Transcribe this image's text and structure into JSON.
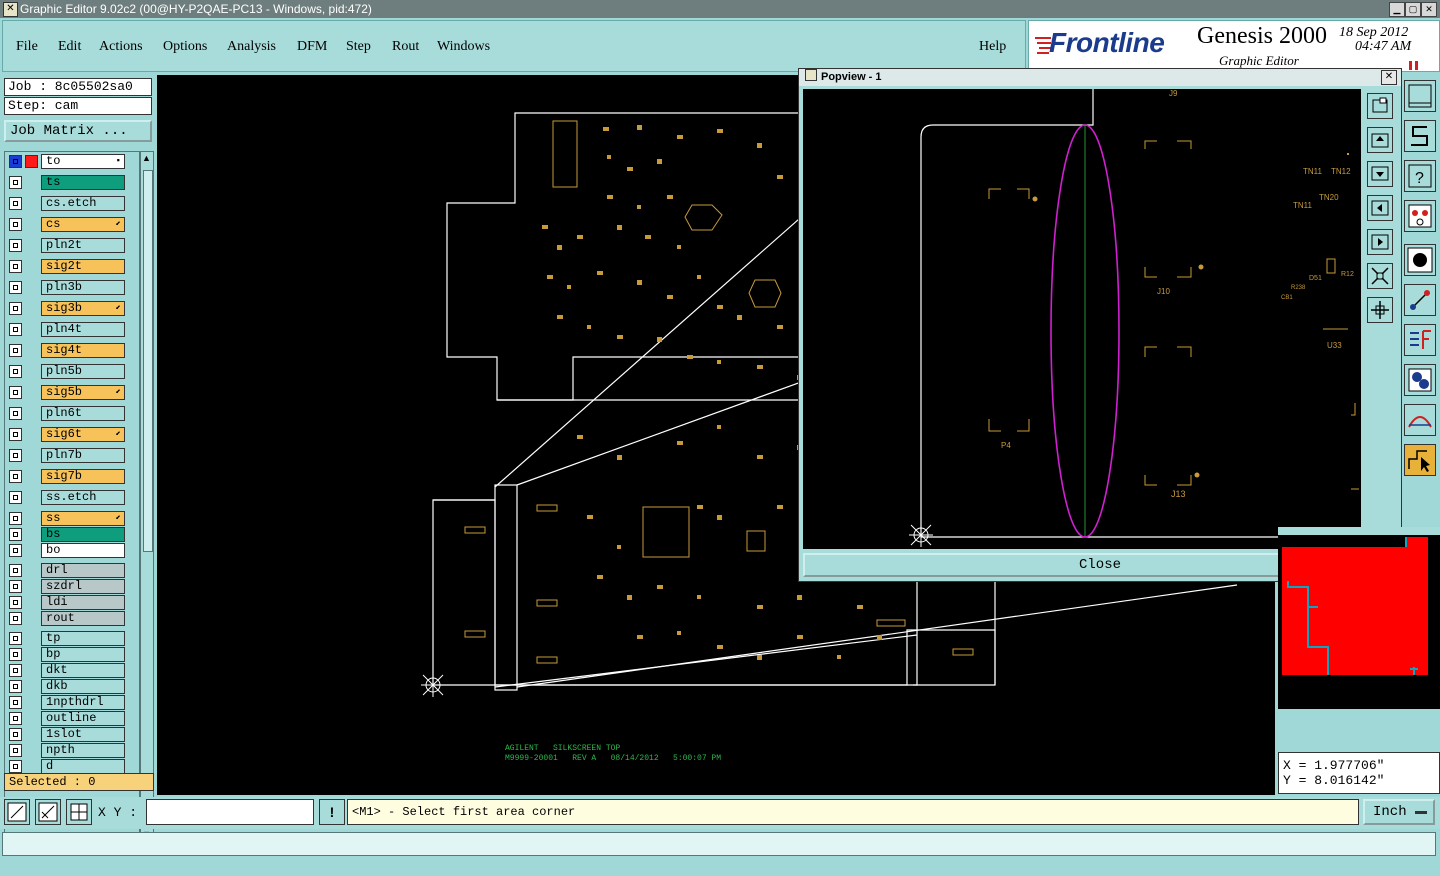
{
  "window": {
    "title": "Graphic Editor 9.02c2 (00@HY-P2QAE-PC13 - Windows, pid:472)"
  },
  "menu": {
    "file": "File",
    "edit": "Edit",
    "actions": "Actions",
    "options": "Options",
    "analysis": "Analysis",
    "dfm": "DFM",
    "step": "Step",
    "rout": "Rout",
    "windows": "Windows",
    "help": "Help"
  },
  "brand": {
    "logo": "Frontline",
    "product": "Genesis 2000",
    "subtitle": "Graphic Editor",
    "date": "18 Sep 2012",
    "time": "04:47 AM"
  },
  "left": {
    "job": "Job : 8c05502sa0",
    "step": "Step: cam",
    "job_matrix": "Job Matrix ...",
    "selected": "Selected : 0"
  },
  "layers": [
    {
      "name": "to",
      "color": "#ffffff",
      "mark": "▪"
    },
    {
      "name": "ts",
      "color": "#0e9d7d",
      "mark": ""
    },
    {
      "name": "cs.etch",
      "color": "#a7dcda",
      "mark": ""
    },
    {
      "name": "cs",
      "color": "#f7c25a",
      "mark": "⬋"
    },
    {
      "name": "pln2t",
      "color": "#a7dcda",
      "mark": ""
    },
    {
      "name": "sig2t",
      "color": "#f7c25a",
      "mark": ""
    },
    {
      "name": "pln3b",
      "color": "#a7dcda",
      "mark": ""
    },
    {
      "name": "sig3b",
      "color": "#f7c25a",
      "mark": "⬋"
    },
    {
      "name": "pln4t",
      "color": "#a7dcda",
      "mark": ""
    },
    {
      "name": "sig4t",
      "color": "#f7c25a",
      "mark": ""
    },
    {
      "name": "pln5b",
      "color": "#a7dcda",
      "mark": ""
    },
    {
      "name": "sig5b",
      "color": "#f7c25a",
      "mark": "⬋"
    },
    {
      "name": "pln6t",
      "color": "#a7dcda",
      "mark": ""
    },
    {
      "name": "sig6t",
      "color": "#f7c25a",
      "mark": "⬋"
    },
    {
      "name": "pln7b",
      "color": "#a7dcda",
      "mark": ""
    },
    {
      "name": "sig7b",
      "color": "#f7c25a",
      "mark": ""
    },
    {
      "name": "ss.etch",
      "color": "#a7dcda",
      "mark": ""
    },
    {
      "name": "ss",
      "color": "#f7c25a",
      "mark": "⬋"
    },
    {
      "name": "bs",
      "color": "#0e9d7d",
      "mark": ""
    },
    {
      "name": "bo",
      "color": "#ffffff",
      "mark": ""
    },
    {
      "name": "drl",
      "color": "#b8c8c8",
      "mark": ""
    },
    {
      "name": "szdrl",
      "color": "#b8c8c8",
      "mark": ""
    },
    {
      "name": "ldi",
      "color": "#b8c8c8",
      "mark": ""
    },
    {
      "name": "rout",
      "color": "#b8c8c8",
      "mark": ""
    },
    {
      "name": "tp",
      "color": "#a7dcda",
      "mark": ""
    },
    {
      "name": "bp",
      "color": "#a7dcda",
      "mark": ""
    },
    {
      "name": "dkt",
      "color": "#a7dcda",
      "mark": ""
    },
    {
      "name": "dkb",
      "color": "#a7dcda",
      "mark": ""
    },
    {
      "name": "1npthdrl",
      "color": "#a7dcda",
      "mark": ""
    },
    {
      "name": "outline",
      "color": "#a7dcda",
      "mark": ""
    },
    {
      "name": "1slot",
      "color": "#a7dcda",
      "mark": ""
    },
    {
      "name": "npth",
      "color": "#a7dcda",
      "mark": ""
    },
    {
      "name": "d",
      "color": "#a7dcda",
      "mark": ""
    }
  ],
  "canvas": {
    "silk_text_line1": "AGILENT   SILKSCREEN TOP",
    "silk_text_line2": "M9999-20001   REV A   08/14/2012   5:00:07 PM"
  },
  "popview": {
    "title": "Popview - 1",
    "close_label": "Close",
    "labels": {
      "j9": "J9",
      "j10": "J10",
      "j13": "J13",
      "p4": "P4",
      "tn11": "TN11",
      "tn12": "TN12",
      "tn20": "TN20",
      "tn11b": "TN11",
      "u33": "U33",
      "d51": "D51",
      "r12": "R12",
      "r238": "R238",
      "cb1": "CB1"
    }
  },
  "coords": {
    "x": "X = 1.977706\"",
    "y": "Y = 8.016142\""
  },
  "bottom": {
    "xy_label": "X Y :",
    "xy_value": "",
    "warn": "!",
    "prompt": "<M1> - Select first area corner",
    "units": "Inch"
  },
  "colors": {
    "accent": "#a7dcda",
    "copper": "#c79a3a",
    "outline": "#ffffff",
    "ellipse": "#d020d0",
    "silk_text": "#2fb84a",
    "minimap_fill": "#ff0000"
  }
}
